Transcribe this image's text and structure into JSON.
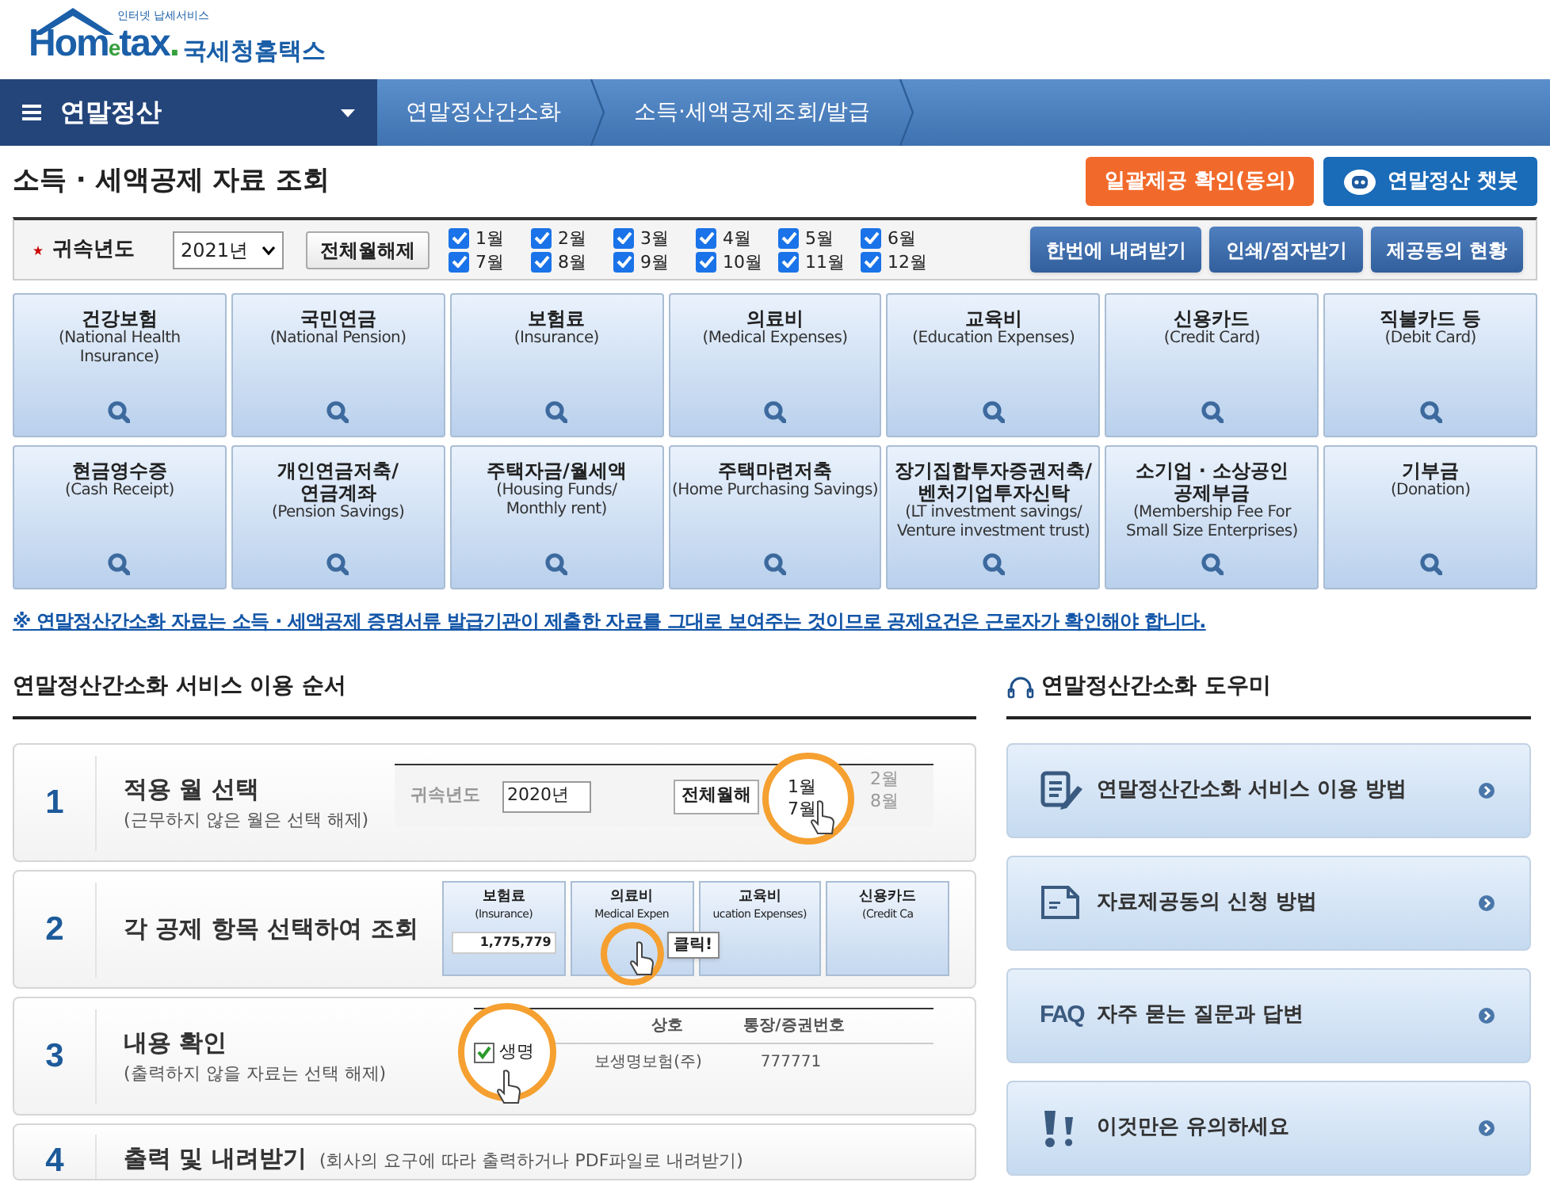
{
  "logo": {
    "tagline": "인터넷 납세서비스",
    "brand": [
      "Hom",
      "e",
      "tax",
      "."
    ],
    "name": "국세청홈택스"
  },
  "nav": {
    "menu": "연말정산",
    "crumbs": [
      "연말정산간소화",
      "소득·세액공제조회/발급"
    ]
  },
  "page_title": "소득 · 세액공제 자료 조회",
  "top_buttons": [
    {
      "label": "일괄제공 확인(동의)",
      "kind": "orange"
    },
    {
      "label": "연말정산 챗봇",
      "kind": "chatbot"
    }
  ],
  "filter": {
    "label": "귀속년도",
    "year": "2021년",
    "clear_button": "전체월해제",
    "months": [
      {
        "label": "1월",
        "checked": true
      },
      {
        "label": "2월",
        "checked": true
      },
      {
        "label": "3월",
        "checked": true
      },
      {
        "label": "4월",
        "checked": true
      },
      {
        "label": "5월",
        "checked": true
      },
      {
        "label": "6월",
        "checked": true
      },
      {
        "label": "7월",
        "checked": true
      },
      {
        "label": "8월",
        "checked": true
      },
      {
        "label": "9월",
        "checked": true
      },
      {
        "label": "10월",
        "checked": true
      },
      {
        "label": "11월",
        "checked": true
      },
      {
        "label": "12월",
        "checked": true
      }
    ],
    "actions": [
      "한번에 내려받기",
      "인쇄/점자받기",
      "제공동의 현황"
    ]
  },
  "tiles": [
    {
      "title": "건강보험",
      "subtitle": "(National Health\nInsurance)"
    },
    {
      "title": "국민연금",
      "subtitle": "(National Pension)"
    },
    {
      "title": "보험료",
      "subtitle": "(Insurance)"
    },
    {
      "title": "의료비",
      "subtitle": "(Medical Expenses)"
    },
    {
      "title": "교육비",
      "subtitle": "(Education Expenses)"
    },
    {
      "title": "신용카드",
      "subtitle": "(Credit Card)"
    },
    {
      "title": "직불카드 등",
      "subtitle": "(Debit Card)"
    },
    {
      "title": "현금영수증",
      "subtitle": "(Cash Receipt)"
    },
    {
      "title": "개인연금저축/\n연금계좌",
      "subtitle": "(Pension Savings)"
    },
    {
      "title": "주택자금/월세액",
      "subtitle": "(Housing Funds/\nMonthly rent)"
    },
    {
      "title": "주택마련저축",
      "subtitle": "(Home Purchasing Savings)"
    },
    {
      "title": "장기집합투자증권저축/\n벤처기업투자신탁",
      "subtitle": "(LT investment savings/\nVenture investment trust)"
    },
    {
      "title": "소기업 · 소상공인\n공제부금",
      "subtitle": "(Membership Fee For\nSmall Size Enterprises)"
    },
    {
      "title": "기부금",
      "subtitle": "(Donation)"
    }
  ],
  "notice": "※ 연말정산간소화 자료는 소득 · 세액공제 증명서류 발급기관이 제출한 자료를 그대로 보여주는 것이므로 공제요건은 근로자가 확인해야 합니다.",
  "steps_heading": "연말정산간소화 서비스 이용 순서",
  "steps": [
    {
      "number": "1",
      "title": "적용 월 선택",
      "note": "(근무하지 않은 월은 선택 해제)",
      "kind": "months",
      "texts": [
        "귀속년도",
        "2020년",
        "전체월해",
        "1월",
        "7월",
        "2월",
        "8월"
      ]
    },
    {
      "number": "2",
      "title": "각 공제 항목 선택하여 조회",
      "kind": "tiles",
      "texts": [
        "보험료",
        "(Insurance)",
        "1,775,779",
        "의료비",
        "Medical Expen",
        "교육비",
        "ucation Expenses)",
        "신용카드",
        "(Credit Ca",
        "클릭!"
      ]
    },
    {
      "number": "3",
      "title": "내용 확인",
      "note": "(출력하지 않을 자료는 선택 해제)",
      "kind": "table",
      "texts": [
        "상호",
        "통장/증권번호",
        "생명",
        "보생명보험(주)",
        "777771"
      ]
    },
    {
      "number": "4",
      "title": "출력 및 내려받기",
      "note": "(회사의 요구에 따라 출력하거나 PDF파일로 내려받기)",
      "kind": "none"
    }
  ],
  "helper_heading": "연말정산간소화 도우미",
  "helper": [
    {
      "label": "연말정산간소화 서비스 이용 방법",
      "kind": "guide"
    },
    {
      "label": "자료제공동의 신청 방법",
      "kind": "document"
    },
    {
      "label": "자주 묻는 질문과 답변",
      "kind": "faq",
      "badge": "FAQ"
    },
    {
      "label": "이것만은 유의하세요",
      "kind": "caution"
    }
  ]
}
